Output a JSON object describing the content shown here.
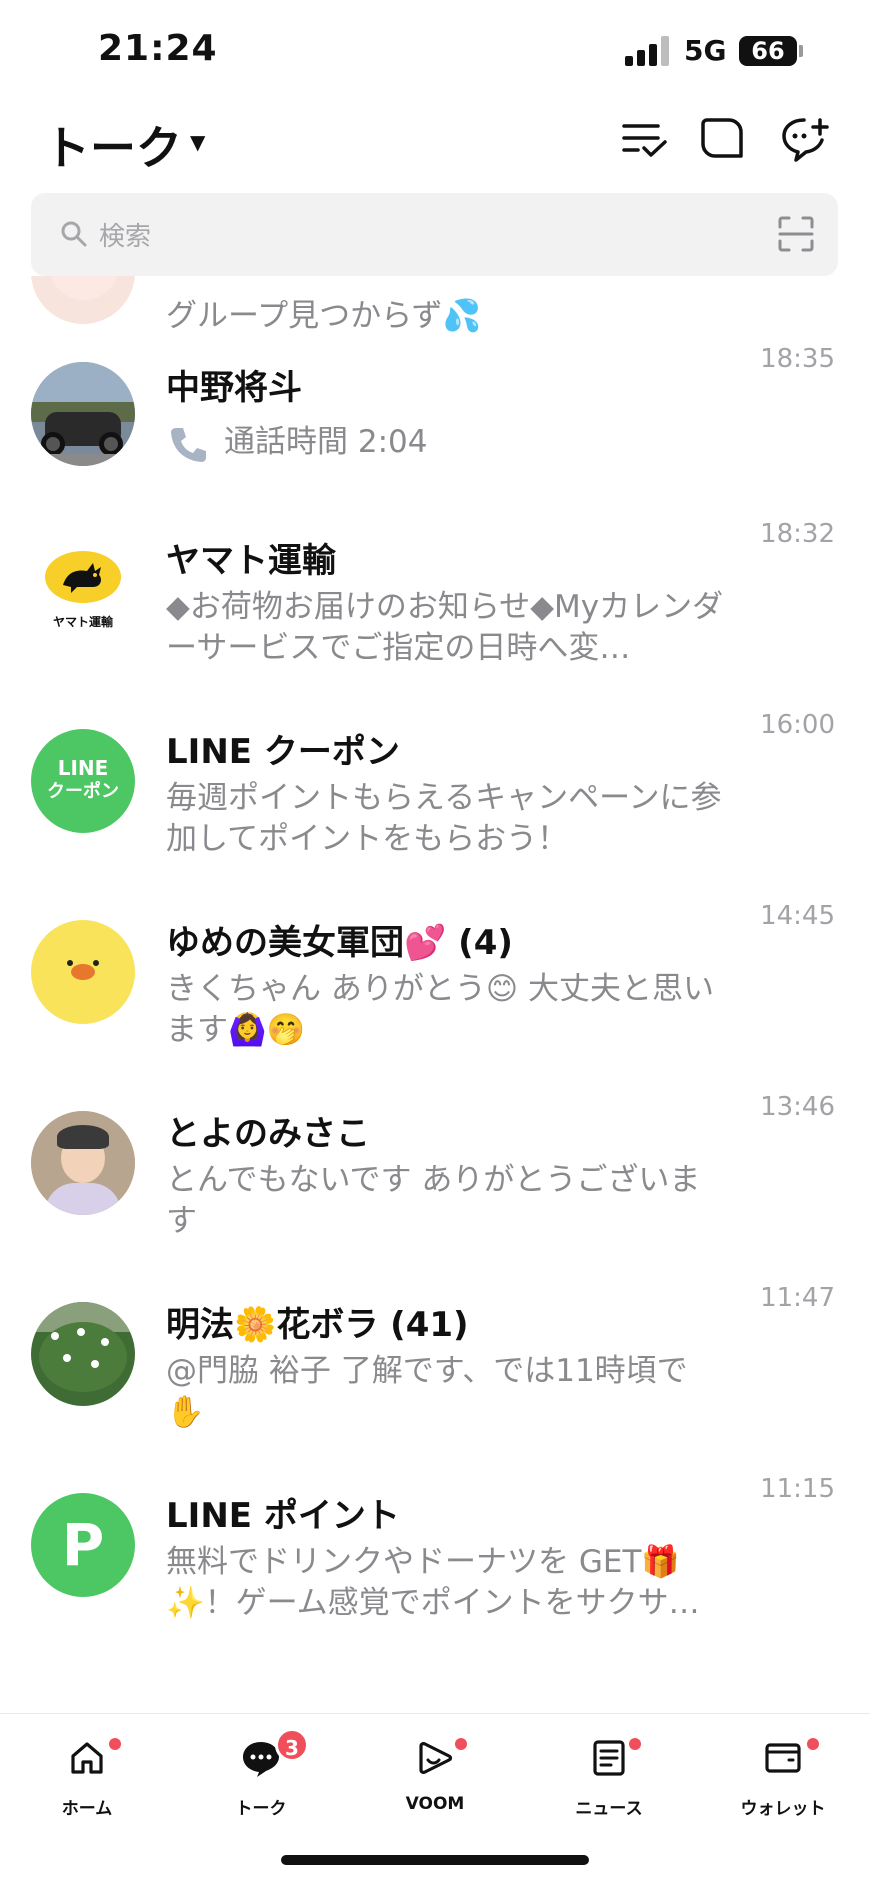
{
  "status_bar": {
    "time": "21:24",
    "network": "5G",
    "battery": "66"
  },
  "header": {
    "title": "トーク"
  },
  "search": {
    "placeholder": "検索"
  },
  "chats": [
    {
      "name": "",
      "preview": "グループ見つからず💦",
      "time": ""
    },
    {
      "name": "中野将斗",
      "preview": "通話時間 2:04",
      "time": "18:35"
    },
    {
      "name": "ヤマト運輸",
      "preview": "◆お荷物お届けのお知らせ◆Myカレンダーサービスでご指定の日時へ変…",
      "time": "18:32",
      "avatar_text": "ヤマト運輸"
    },
    {
      "name": "LINE クーポン",
      "preview": "毎週ポイントもらえるキャンペーンに参加してポイントをもらおう！",
      "time": "16:00",
      "avatar_text_1": "LINE",
      "avatar_text_2": "クーポン"
    },
    {
      "name": "ゆめの美女軍団💕 (4)",
      "preview": "きくちゃん ありがとう😊 大丈夫と思います🙆‍♀️🤭",
      "time": "14:45"
    },
    {
      "name": "とよのみさこ",
      "preview": "とんでもないです ありがとうございます",
      "time": "13:46"
    },
    {
      "name": "明法🌼花ボラ (41)",
      "preview": "@門脇 裕子  了解です、では11時頃で✋",
      "time": "11:47"
    },
    {
      "name": "LINE ポイント",
      "preview": "無料でドリンクやドーナツを GET🎁✨！ゲーム感覚でポイントをサクサ…",
      "time": "11:15",
      "avatar_text": "P"
    }
  ],
  "nav": {
    "home": "ホーム",
    "talk": "トーク",
    "talk_badge": "3",
    "voom": "VOOM",
    "news": "ニュース",
    "wallet": "ウォレット"
  },
  "colors": {
    "line_green": "#4cc764",
    "badge_red": "#f04e5a",
    "yamato_yellow": "#f7cf28"
  }
}
